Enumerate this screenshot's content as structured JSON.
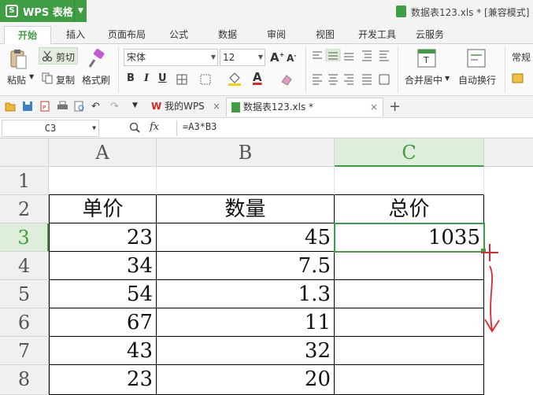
{
  "titlebar": {
    "app_label": "WPS 表格",
    "doc_title": "数据表123.xls * [兼容模式] -"
  },
  "tabs": [
    "开始",
    "插入",
    "页面布局",
    "公式",
    "数据",
    "审阅",
    "视图",
    "开发工具",
    "云服务"
  ],
  "ribbon": {
    "cut": "剪切",
    "paste": "粘贴",
    "copy": "复制",
    "format_painter": "格式刷",
    "font_name": "宋体",
    "font_size": "12",
    "bold": "B",
    "italic": "I",
    "underline": "U",
    "merge_center": "合并居中",
    "wrap_text": "自动换行",
    "number_format": "常规"
  },
  "doc_tabs": {
    "home": "我的WPS",
    "current": "数据表123.xls *"
  },
  "formula_bar": {
    "name_box": "C3",
    "fx": "fx",
    "formula": "=A3*B3"
  },
  "grid": {
    "columns": [
      "A",
      "B",
      "C"
    ],
    "rows": [
      "1",
      "2",
      "3",
      "4",
      "5",
      "6",
      "7",
      "8"
    ],
    "headers": {
      "a": "单价",
      "b": "数量",
      "c": "总价"
    },
    "data": [
      {
        "a": "23",
        "b": "45",
        "c": "1035"
      },
      {
        "a": "34",
        "b": "7.5",
        "c": ""
      },
      {
        "a": "54",
        "b": "1.3",
        "c": ""
      },
      {
        "a": "67",
        "b": "11",
        "c": ""
      },
      {
        "a": "43",
        "b": "32",
        "c": ""
      },
      {
        "a": "23",
        "b": "20",
        "c": ""
      }
    ],
    "selected_cell": "C3"
  },
  "colors": {
    "accent": "#3f9e43",
    "annotation": "#e0242b"
  },
  "icons": [
    "wps-logo-icon",
    "scissors-icon",
    "paste-icon",
    "copy-icon",
    "brush-icon",
    "save-icon",
    "undo-icon",
    "redo-icon",
    "close-icon",
    "plus-icon",
    "search-icon",
    "plus-cross-annotation",
    "down-arrow-annotation"
  ]
}
